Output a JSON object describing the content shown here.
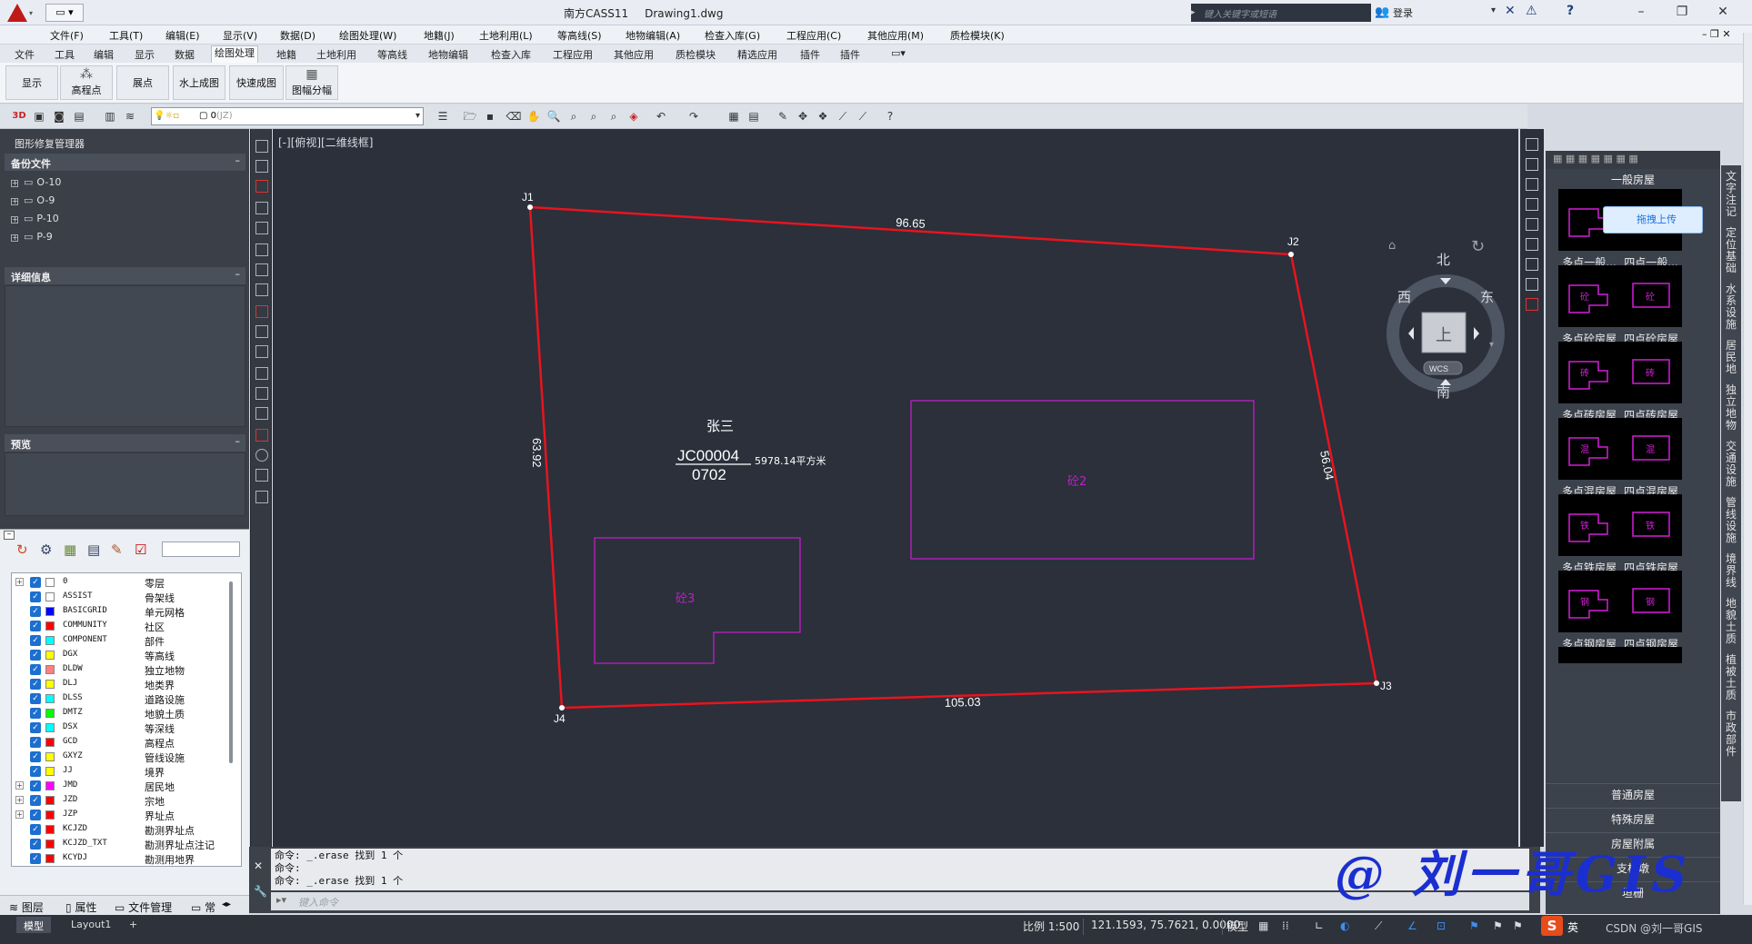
{
  "window": {
    "app_name": "南方CASS11",
    "file_name": "Drawing1.dwg",
    "qat_label": "▭ ▾",
    "search_placeholder": "键入关键字或短语",
    "login_label": "登录"
  },
  "menubar": [
    "文件(F)",
    "工具(T)",
    "编辑(E)",
    "显示(V)",
    "数据(D)",
    "绘图处理(W)",
    "地籍(J)",
    "土地利用(L)",
    "等高线(S)",
    "地物编辑(A)",
    "检查入库(G)",
    "工程应用(C)",
    "其他应用(M)",
    "质检模块(K)"
  ],
  "ribbon_tabs": [
    "文件",
    "工具",
    "编辑",
    "显示",
    "数据",
    "绘图处理",
    "地籍",
    "土地利用",
    "等高线",
    "地物编辑",
    "检查入库",
    "工程应用",
    "其他应用",
    "质检模块",
    "精选应用",
    "插件",
    "插件"
  ],
  "ribbon_active_tab": "绘图处理",
  "ribbon_buttons": [
    "显示",
    "高程点",
    "展点",
    "水上成图",
    "快速成图",
    "图幅分幅"
  ],
  "layer_combo": {
    "value": "0",
    "suffix": "(JZ)"
  },
  "left_panel": {
    "title": "图形修复管理器",
    "backup_header": "备份文件",
    "backups": [
      "O-10",
      "O-9",
      "P-10",
      "P-9"
    ],
    "detail_header": "详细信息",
    "preview_header": "预览"
  },
  "layers": [
    {
      "name": "0",
      "desc": "零层",
      "color": "#ffffff",
      "expand": true
    },
    {
      "name": "ASSIST",
      "desc": "骨架线",
      "color": "#ffffff",
      "expand": false
    },
    {
      "name": "BASICGRID",
      "desc": "单元网格",
      "color": "#0000ff",
      "expand": false
    },
    {
      "name": "COMMUNITY",
      "desc": "社区",
      "color": "#ff0000",
      "expand": false
    },
    {
      "name": "COMPONENT",
      "desc": "部件",
      "color": "#00ffff",
      "expand": false
    },
    {
      "name": "DGX",
      "desc": "等高线",
      "color": "#ffff00",
      "expand": false
    },
    {
      "name": "DLDW",
      "desc": "独立地物",
      "color": "#ff8080",
      "expand": false
    },
    {
      "name": "DLJ",
      "desc": "地类界",
      "color": "#ffff00",
      "expand": false
    },
    {
      "name": "DLSS",
      "desc": "道路设施",
      "color": "#00ffff",
      "expand": false
    },
    {
      "name": "DMTZ",
      "desc": "地貌土质",
      "color": "#00ff00",
      "expand": false
    },
    {
      "name": "DSX",
      "desc": "等深线",
      "color": "#00ffff",
      "expand": false
    },
    {
      "name": "GCD",
      "desc": "高程点",
      "color": "#ff0000",
      "expand": false
    },
    {
      "name": "GXYZ",
      "desc": "管线设施",
      "color": "#ffff00",
      "expand": false
    },
    {
      "name": "JJ",
      "desc": "境界",
      "color": "#ffff00",
      "expand": false
    },
    {
      "name": "JMD",
      "desc": "居民地",
      "color": "#ff00ff",
      "expand": true
    },
    {
      "name": "JZD",
      "desc": "宗地",
      "color": "#ff0000",
      "expand": true
    },
    {
      "name": "JZP",
      "desc": "界址点",
      "color": "#ff0000",
      "expand": true
    },
    {
      "name": "KCJZD",
      "desc": "勘测界址点",
      "color": "#ff0000",
      "expand": false
    },
    {
      "name": "KCJZD_TXT",
      "desc": "勘测界址点注记",
      "color": "#ff0000",
      "expand": false
    },
    {
      "name": "KCYDJ",
      "desc": "勘测用地界",
      "color": "#ff0000",
      "expand": false
    }
  ],
  "bottom_tabs": [
    "图层",
    "属性",
    "文件管理",
    "常"
  ],
  "view_label": "[-][俯视][二维线框]",
  "drawing": {
    "points": [
      "J1",
      "J2",
      "J3",
      "J4"
    ],
    "edge_lengths": [
      "96.65",
      "56.04",
      "105.03",
      "63.92"
    ],
    "owner": "张三",
    "parcel_code": "JC00004",
    "parcel_num": "0702",
    "area": "5978.14平方米",
    "building_a": "砼2",
    "building_b": "砼3",
    "boundary_color": "#e8141e",
    "building_color": "#c01fc8"
  },
  "viewcube": {
    "north": "北",
    "south": "南",
    "east": "东",
    "west": "西",
    "face": "上",
    "wcs": "WCS"
  },
  "command": {
    "lines": [
      "命令: _.erase 找到 1 个",
      "命令:",
      "命令: _.erase 找到 1 个"
    ],
    "placeholder": "键入命令"
  },
  "palette": {
    "header": "一般房屋",
    "upload": "拖拽上传",
    "items": [
      [
        "多点一般...",
        "四点一般..."
      ],
      [
        "多点砼房屋",
        "四点砼房屋"
      ],
      [
        "多点砖房屋",
        "四点砖房屋"
      ],
      [
        "多点混房屋",
        "四点混房屋"
      ],
      [
        "多点铁房屋",
        "四点铁房屋"
      ],
      [
        "多点钢房屋",
        "四点钢房屋"
      ]
    ],
    "icon_marks": [
      [
        "",
        ""
      ],
      [
        "砼",
        "砼"
      ],
      [
        "砖",
        "砖"
      ],
      [
        "混",
        "混"
      ],
      [
        "铁",
        "铁"
      ],
      [
        "钢",
        "钢"
      ]
    ],
    "categories": [
      "普通房屋",
      "特殊房屋",
      "房屋附属",
      "支柱墩",
      "垣栅"
    ],
    "vertical_tabs": [
      "文字注记",
      "定位基础",
      "水系设施",
      "居民地",
      "独立地物",
      "交通设施",
      "管线设施",
      "境界线",
      "地貌土质",
      "植被土质",
      "市政部件"
    ]
  },
  "status": {
    "layout_tabs": [
      "模型",
      "Layout1",
      "+"
    ],
    "scale": "比例 1:500",
    "coords": "121.1593, 75.7621, 0.0000",
    "model": "模型",
    "ime": "英",
    "csdn": "CSDN @刘一哥GIS"
  },
  "watermark": "@ 刘一哥GIS"
}
